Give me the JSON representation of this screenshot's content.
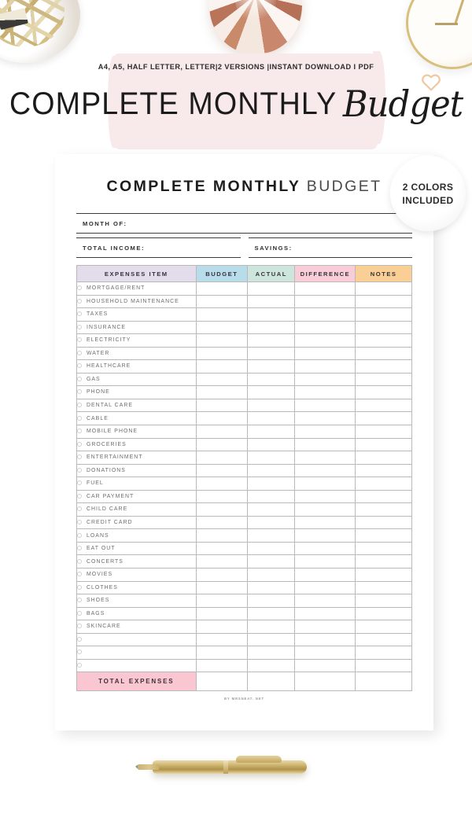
{
  "listing": {
    "subtitle": "A4, A5, HALF LETTER, LETTER|2 VERSIONS |INSTANT DOWNLOAD I PDF",
    "title_main": "COMPLETE MONTHLY",
    "title_script": "Budget",
    "badge_line1": "2 COLORS",
    "badge_line2": "INCLUDED"
  },
  "document": {
    "title_bold": "COMPLETE MONTHLY",
    "title_light": "BUDGET",
    "fields": {
      "month_of": "MONTH OF:",
      "total_income": "TOTAL INCOME:",
      "savings": "SAVINGS:"
    },
    "table": {
      "headers": [
        "EXPENSES ITEM",
        "BUDGET",
        "ACTUAL",
        "DIFFERENCE",
        "NOTES"
      ],
      "items": [
        "MORTGAGE/RENT",
        "HOUSEHOLD MAINTENANCE",
        "TAXES",
        "INSURANCE",
        "ELECTRICITY",
        "WATER",
        "HEALTHCARE",
        "GAS",
        "PHONE",
        "DENTAL CARE",
        "CABLE",
        "MOBILE PHONE",
        "GROCERIES",
        "ENTERTAINMENT",
        "DONATIONS",
        "FUEL",
        "CAR PAYMENT",
        "CHILD CARE",
        "CREDIT CARD",
        "LOANS",
        "EAT OUT",
        "CONCERTS",
        "MOVIES",
        "CLOTHES",
        "SHOES",
        "BAGS",
        "SKINCARE",
        "",
        "",
        ""
      ],
      "total_label": "TOTAL EXPENSES"
    },
    "credit": "BY  MRSNEAT. NET"
  },
  "colors": {
    "header_item": "#e3dcea",
    "header_budget": "#b9dcea",
    "header_actual": "#cde5dd",
    "header_difference": "#f9cdd8",
    "header_notes": "#f9cf96",
    "total_row": "#f9c6d2",
    "banner_pink": "#f8eaea",
    "heart": "#eec9a4"
  },
  "decor": {
    "photo_clips": "binder-clips-in-bowl",
    "photo_ribbon": "copper-ribbon-ornament",
    "photo_clock": "gold-clock",
    "photo_pen": "gold-ballpoint-pen"
  }
}
